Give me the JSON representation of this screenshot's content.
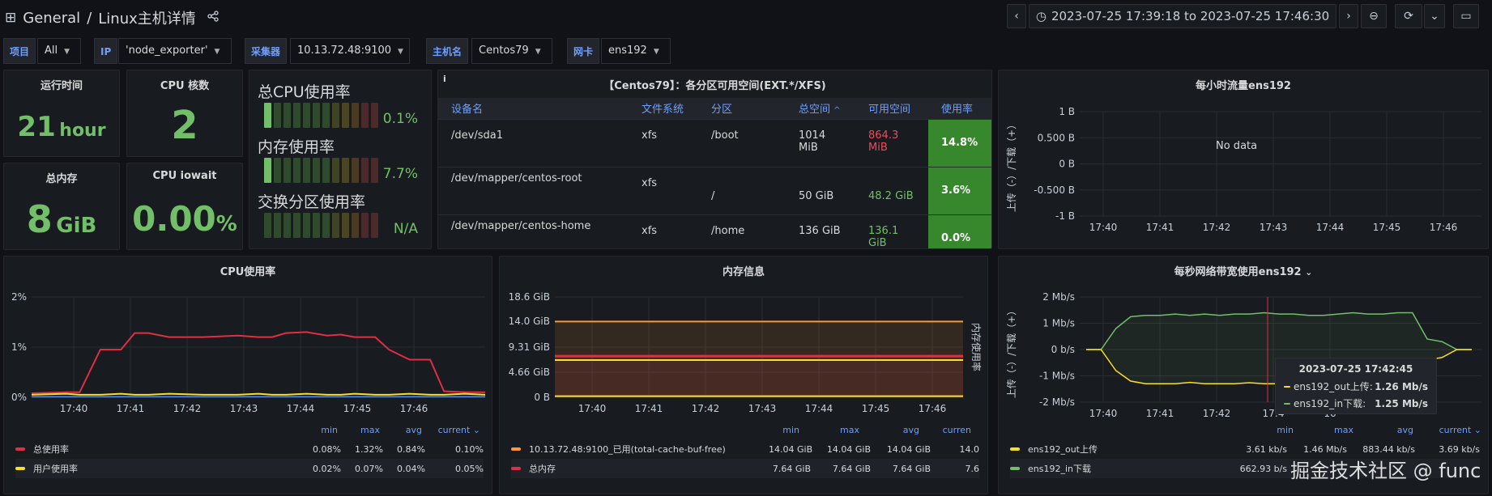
{
  "header": {
    "folder": "General",
    "separator": "/",
    "title": "Linux主机详情",
    "time_range": "2023-07-25 17:39:18 to 2023-07-25 17:46:30"
  },
  "variables": [
    {
      "label": "项目",
      "value": "All"
    },
    {
      "label": "IP",
      "value": "'node_exporter'"
    },
    {
      "label": "采集器",
      "value": "10.13.72.48:9100"
    },
    {
      "label": "主机名",
      "value": "Centos79"
    },
    {
      "label": "网卡",
      "value": "ens192"
    }
  ],
  "stats": {
    "uptime": {
      "title": "运行时间",
      "value": "21",
      "unit": "hour"
    },
    "cpu_cores": {
      "title": "CPU 核数",
      "value": "2"
    },
    "total_mem": {
      "title": "总内存",
      "value": "8",
      "unit": "GiB"
    },
    "iowait": {
      "title": "CPU iowait",
      "value": "0.00",
      "unit": "%"
    }
  },
  "gauges": [
    {
      "label": "总CPU使用率",
      "value": "0.1%",
      "fill_fraction": 0.1
    },
    {
      "label": "内存使用率",
      "value": "7.7%",
      "fill_fraction": 0.1
    },
    {
      "label": "交换分区使用率",
      "value": "N/A",
      "fill_fraction": 0
    }
  ],
  "disk_table": {
    "title": "【Centos79】：各分区可用空间(EXT.*/XFS)",
    "info_icon": "i",
    "columns": [
      "设备名",
      "文件系统",
      "分区",
      "总空间",
      "可用空间",
      "使用率"
    ],
    "sort_indicator": "^",
    "rows": [
      {
        "device": "/dev/sda1",
        "fs": "xfs",
        "mount": "/boot",
        "total": "1014 MiB",
        "avail": "864.3 MiB",
        "avail_color": "#f2495c",
        "usage": "14.8%"
      },
      {
        "device": "/dev/mapper/centos-root",
        "fs": "xfs",
        "mount": "/",
        "total": "50 GiB",
        "avail": "48.2 GiB",
        "avail_color": "#73bf69",
        "usage": "3.6%"
      },
      {
        "device": "/dev/mapper/centos-home",
        "fs": "xfs",
        "mount": "/home",
        "total": "136 GiB",
        "avail": "136.1 GiB",
        "avail_color": "#73bf69",
        "usage": "0.0%"
      }
    ]
  },
  "hourly": {
    "title": "每小时流量ens192",
    "no_data": "No data",
    "y_label": "上传（-）/下载（+）",
    "y_ticks": [
      "1 B",
      "0.500 B",
      "0 B",
      "-0.500 B",
      "-1 B"
    ],
    "x_ticks": [
      "17:40",
      "17:41",
      "17:42",
      "17:43",
      "17:44",
      "17:45",
      "17:46"
    ]
  },
  "cpu_chart": {
    "title": "CPU使用率",
    "y_ticks": [
      "2%",
      "1%",
      "0%"
    ],
    "x_ticks": [
      "17:40",
      "17:41",
      "17:42",
      "17:43",
      "17:44",
      "17:45",
      "17:46"
    ],
    "legend_headers": [
      "min",
      "max",
      "avg",
      "current"
    ],
    "legend": [
      {
        "name": "总使用率",
        "color": "#e02f44",
        "min": "0.08%",
        "max": "1.32%",
        "avg": "0.84%",
        "current": "0.10%"
      },
      {
        "name": "用户使用率",
        "color": "#fade2a",
        "min": "0.02%",
        "max": "0.07%",
        "avg": "0.04%",
        "current": "0.05%"
      }
    ]
  },
  "mem_chart": {
    "title": "内存信息",
    "y_label": "内存使用率",
    "y_ticks": [
      "18.6 GiB",
      "14.0 GiB",
      "9.31 GiB",
      "4.66 GiB",
      "0 B"
    ],
    "x_ticks": [
      "17:40",
      "17:41",
      "17:42",
      "17:43",
      "17:44",
      "17:45",
      "17:46"
    ],
    "legend_headers": [
      "min",
      "max",
      "avg",
      "curren"
    ],
    "legend": [
      {
        "name": "10.13.72.48:9100_已用(total-cache-buf-free)",
        "color": "#ff9830",
        "min": "14.04 GiB",
        "max": "14.04 GiB",
        "avg": "14.04 GiB",
        "current": "14.0"
      },
      {
        "name": "总内存",
        "color": "#e02f44",
        "min": "7.64 GiB",
        "max": "7.64 GiB",
        "avg": "7.64 GiB",
        "current": "7.6"
      }
    ]
  },
  "net_chart": {
    "title": "每秒网络带宽使用ens192",
    "y_label": "上传（-）/下载（+）",
    "y_ticks": [
      "2 Mb/s",
      "1 Mb/s",
      "0 b/s",
      "-1 Mb/s",
      "-2 Mb/s"
    ],
    "x_ticks": [
      "17:40",
      "17:41",
      "17:42",
      "17:4",
      "16"
    ],
    "legend_headers": [
      "min",
      "max",
      "avg",
      "current"
    ],
    "legend": [
      {
        "name": "ens192_out上传",
        "color": "#fade2a",
        "min": "3.61 kb/s",
        "max": "1.46 Mb/s",
        "avg": "883.44 kb/s",
        "current": "3.69 kb/s"
      },
      {
        "name": "ens192_in下载",
        "color": "#73bf69",
        "min": "662.93 b/s",
        "max": "",
        "avg": "",
        "current": ""
      }
    ],
    "tooltip": {
      "time": "2023-07-25 17:42:45",
      "rows": [
        {
          "name": "ens192_out上传:",
          "value": "1.26 Mb/s",
          "color": "#fade2a"
        },
        {
          "name": "ens192_in下载:",
          "value": "1.25 Mb/s",
          "color": "#73bf69"
        }
      ]
    }
  },
  "cpu_series": {
    "x": [
      0,
      0.5,
      0.7,
      1,
      1.3,
      1.5,
      1.7,
      2,
      2.5,
      3,
      3.3,
      3.5,
      3.7,
      4,
      4.3,
      4.5,
      4.7,
      5,
      5.2,
      5.5,
      5.8,
      6,
      6.3,
      6.6
    ],
    "total": [
      0.08,
      0.1,
      0.1,
      0.95,
      0.95,
      1.28,
      1.28,
      1.2,
      1.2,
      1.23,
      1.2,
      1.2,
      1.28,
      1.3,
      1.23,
      1.25,
      1.2,
      1.2,
      0.95,
      0.75,
      0.75,
      0.12,
      0.1,
      0.1
    ]
  },
  "net_series": {
    "in": [
      0,
      0,
      0.8,
      1.25,
      1.3,
      1.3,
      1.35,
      1.3,
      1.35,
      1.3,
      1.35,
      1.35,
      1.4,
      1.35,
      1.35,
      1.3,
      1.3,
      1.35,
      1.4,
      1.35,
      1.35,
      1.4,
      1.4,
      0.4,
      0.3,
      0,
      0
    ],
    "out": [
      0,
      0,
      -0.8,
      -1.2,
      -1.3,
      -1.3,
      -1.3,
      -1.25,
      -1.3,
      -1.3,
      -1.3,
      -1.26,
      -1.3,
      -1.3,
      -1.3,
      -1.3,
      -1.28,
      -1.3,
      -1.3,
      -1.3,
      -1.3,
      -1.35,
      -1.35,
      -0.4,
      -0.3,
      0,
      0
    ]
  },
  "watermark": "掘金技术社区 @ func",
  "icons": [
    "grid-icon",
    "share-icon",
    "chevron-left-icon",
    "clock-icon",
    "chevron-right-icon",
    "zoom-out-icon",
    "refresh-icon",
    "chevron-down-icon",
    "tv-icon",
    "info-icon"
  ]
}
